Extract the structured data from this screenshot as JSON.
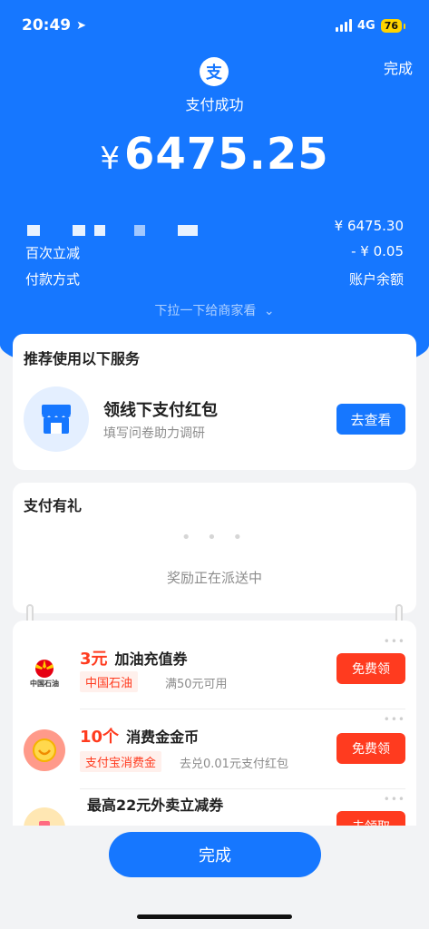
{
  "status_bar": {
    "time": "20:49",
    "network": "4G",
    "battery": "76"
  },
  "header": {
    "done_label": "完成",
    "logo_glyph": "支",
    "status": "支付成功",
    "currency": "¥",
    "amount": "6475.25"
  },
  "details": {
    "original_amount": "¥ 6475.30",
    "discount_label": "百次立减",
    "discount_value": "- ¥ 0.05",
    "payment_method_label": "付款方式",
    "payment_method_value": "账户余额",
    "pull_hint": "下拉一下给商家看"
  },
  "recommend": {
    "title": "推荐使用以下服务",
    "item_title": "领线下支付红包",
    "item_subtitle": "填写问卷助力调研",
    "button": "去查看"
  },
  "gift": {
    "title": "支付有礼",
    "loading_text": "奖励正在派送中"
  },
  "offers": [
    {
      "highlight": "3元",
      "title": "加油充值券",
      "tag": "中国石油",
      "desc": "满50元可用",
      "button": "免费领",
      "icon_text": "中国石油"
    },
    {
      "highlight": "10个",
      "title": "消费金金币",
      "tag": "支付宝消费金",
      "desc": "去兑0.01元支付红包",
      "button": "免费领"
    },
    {
      "highlight": "",
      "title": "最高22元外卖立减券",
      "button": "去领取"
    }
  ],
  "footer": {
    "done_label": "完成"
  },
  "colors": {
    "brand_blue": "#1677ff",
    "accent_red": "#ff3b1f",
    "battery_yellow": "#ffd400"
  }
}
